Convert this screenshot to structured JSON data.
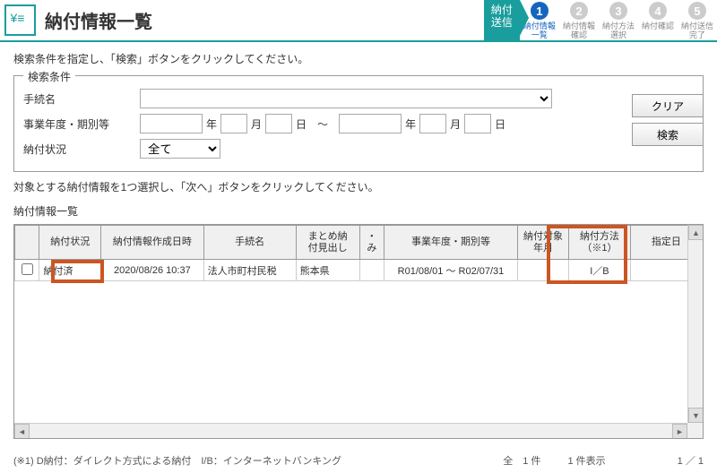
{
  "header": {
    "title": "納付情報一覧",
    "step_first": "納付\n送信",
    "steps": [
      {
        "num": "1",
        "label": "納付情報\n一覧",
        "active": true
      },
      {
        "num": "2",
        "label": "納付情報\n確認",
        "active": false
      },
      {
        "num": "3",
        "label": "納付方法\n選択",
        "active": false
      },
      {
        "num": "4",
        "label": "納付確認",
        "active": false
      },
      {
        "num": "5",
        "label": "納付送信\n完了",
        "active": false
      }
    ]
  },
  "instruction1": "検索条件を指定し、「検索」ボタンをクリックしてください。",
  "search": {
    "legend": "検索条件",
    "label_tetsuzuki": "手続名",
    "label_nendo": "事業年度・期別等",
    "label_status": "納付状況",
    "status_value": "全て",
    "unit_year": "年",
    "unit_month": "月",
    "unit_day": "日",
    "range_sep": "～",
    "btn_clear": "クリア",
    "btn_search": "検索"
  },
  "instruction2": "対象とする納付情報を1つ選択し、「次へ」ボタンをクリックしてください。",
  "table_label": "納付情報一覧",
  "columns": {
    "c1": "",
    "c2": "納付状況",
    "c3": "納付情報作成日時",
    "c4": "手続名",
    "c5": "まとめ納付見出し",
    "c6": "・み",
    "c7": "事業年度・期別等",
    "c8": "納付対象年月",
    "c9": "納付方法（※1）",
    "c10": "指定日"
  },
  "row": {
    "status": "納付済",
    "created": "2020/08/26 10:37",
    "tetsuzuki": "法人市町村民税",
    "matome": "熊本県",
    "nendo": "R01/08/01 ～ R02/07/31",
    "method": "I／B"
  },
  "footer": {
    "legend": "(※1) D納付：ダイレクト方式による納付　I/B：インターネットバンキング",
    "total_label": "全",
    "total_count": "1 件",
    "display": "1 件表示",
    "page": "1 ／ 1"
  }
}
